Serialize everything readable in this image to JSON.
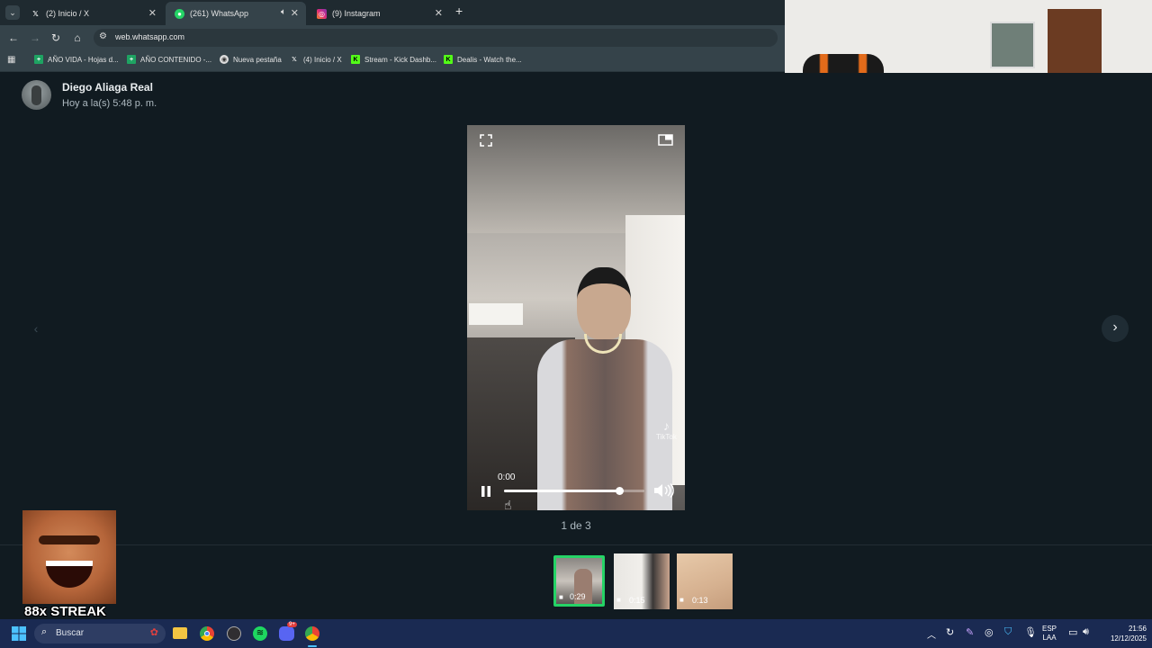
{
  "browser": {
    "tabs": [
      {
        "label": "(2) Inicio / X",
        "favicon": "X"
      },
      {
        "label": "(261) WhatsApp",
        "favicon": "W"
      },
      {
        "label": "(9) Instagram",
        "favicon": "I"
      }
    ],
    "url": "web.whatsapp.com",
    "bookmarks": [
      {
        "label": "AÑO VIDA - Hojas d..."
      },
      {
        "label": "AÑO CONTENIDO -..."
      },
      {
        "label": "Nueva pestaña"
      },
      {
        "label": "(4) Inicio / X"
      },
      {
        "label": "Stream - Kick Dashb..."
      },
      {
        "label": "Dealis - Watch the..."
      }
    ]
  },
  "viewer": {
    "sender_name": "Diego Aliaga Real",
    "timestamp": "Hoy a la(s) 5:48 p. m.",
    "video_time": "0:00",
    "video_progress": 0.82,
    "counter": "1 de 3",
    "watermark": "TikTok",
    "thumbnails": [
      {
        "duration": "0:29",
        "selected": true
      },
      {
        "duration": "0:15",
        "selected": false
      },
      {
        "duration": "0:13",
        "selected": false
      }
    ]
  },
  "overlay": {
    "streak_label": "88x STREAK"
  },
  "taskbar": {
    "search_placeholder": "Buscar",
    "language_top": "ESP",
    "language_bottom": "LAA",
    "time": "21:56",
    "date": "12/12/2025",
    "discord_badge": "9+"
  },
  "colors": {
    "accent_green": "#25d366",
    "bg_dark": "#111b21",
    "taskbar": "#1a2a52"
  }
}
